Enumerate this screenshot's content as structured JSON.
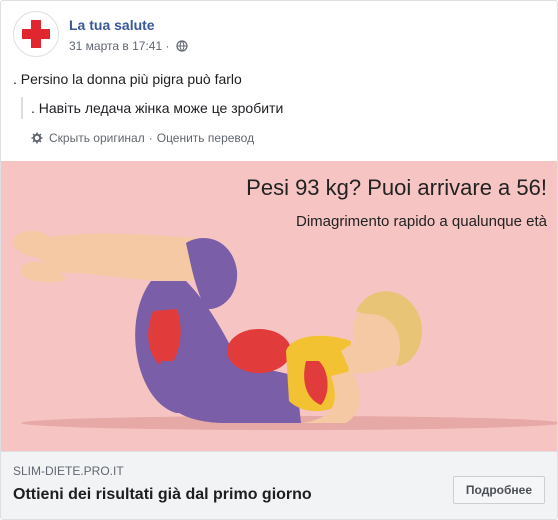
{
  "post": {
    "page_name": "La tua salute",
    "timestamp": "31 марта в 17:41",
    "separator": "·",
    "privacy_icon": "globe-icon",
    "avatar_icon": "red-cross-icon",
    "text": ". Persino la donna più pigra può farlo",
    "translation": ". Навіть ледача жінка може це зробити",
    "translate_actions": {
      "settings_icon": "gear-icon",
      "hide_original": "Скрыть оригинал",
      "separator": "·",
      "rate_translation": "Оценить перевод"
    }
  },
  "ad": {
    "headline": "Pesi 93 kg? Puoi arrivare a 56!",
    "subheadline": "Dimagrimento rapido a qualunque età",
    "illustration": "woman-doing-crunches"
  },
  "link": {
    "domain": "SLIM-DIETE.PRO.IT",
    "title": "Ottieni dei risultati già dal primo giorno",
    "cta": "Подробнее"
  },
  "colors": {
    "page_name": "#385898",
    "ad_background": "#f6c5c3",
    "red_cross": "#e0262e",
    "link_bar": "#f2f3f5"
  }
}
